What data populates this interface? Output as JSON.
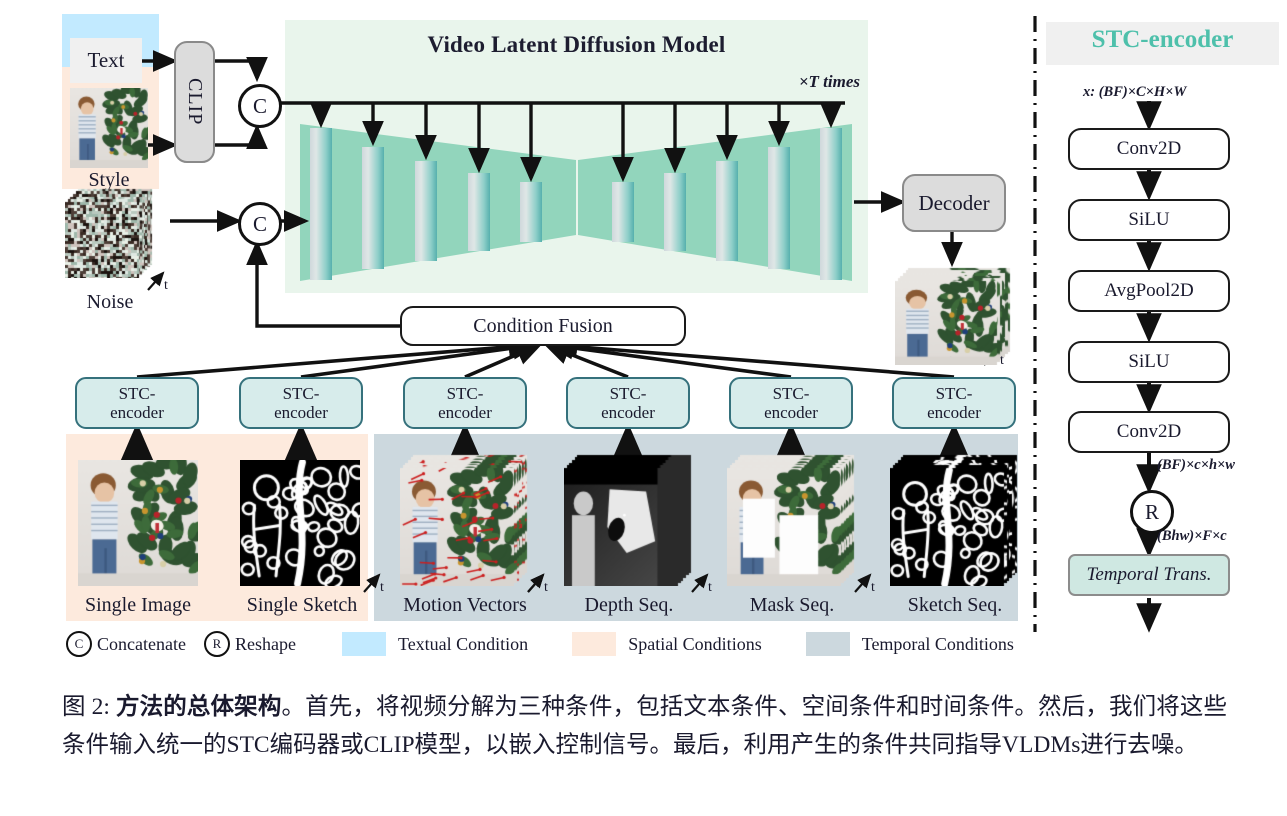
{
  "figure": {
    "panel_title": "Video Latent Diffusion Model",
    "times_label": "×T times",
    "decoder_label": "Decoder",
    "clip_label": "CLIP",
    "condition_fusion_label": "Condition Fusion",
    "concat_symbol": "C",
    "reshape_symbol": "R",
    "time_axis_label": "t"
  },
  "inputs": {
    "text_label": "Text",
    "style_label": "Style",
    "noise_label": "Noise"
  },
  "conditions": [
    {
      "label": "Single Image",
      "encoder": "STC-\nencoder",
      "group": "spatial"
    },
    {
      "label": "Single Sketch",
      "encoder": "STC-\nencoder",
      "group": "spatial"
    },
    {
      "label": "Motion Vectors",
      "encoder": "STC-\nencoder",
      "group": "temporal"
    },
    {
      "label": "Depth Seq.",
      "encoder": "STC-\nencoder",
      "group": "temporal"
    },
    {
      "label": "Mask Seq.",
      "encoder": "STC-\nencoder",
      "group": "temporal"
    },
    {
      "label": "Sketch Seq.",
      "encoder": "STC-\nencoder",
      "group": "temporal"
    }
  ],
  "encoder_label_line1": "STC-",
  "encoder_label_line2": "encoder",
  "stc_panel": {
    "title": "STC-encoder",
    "input_dim": "x: (BF)×C×H×W",
    "blocks": [
      "Conv2D",
      "SiLU",
      "AvgPool2D",
      "SiLU",
      "Conv2D"
    ],
    "dim_after_conv": "(BF)×c×h×w",
    "reshape_symbol": "R",
    "dim_after_reshape": "(Bhw)×F×c",
    "temporal_block": "Temporal Trans."
  },
  "legend": [
    {
      "kind": "circle",
      "symbol": "C",
      "label": "Concatenate"
    },
    {
      "kind": "circle",
      "symbol": "R",
      "label": "Reshape"
    },
    {
      "kind": "swatch",
      "color": "#c2eaff",
      "label": "Textual Condition"
    },
    {
      "kind": "swatch",
      "color": "#fdeadd",
      "label": "Spatial Conditions"
    },
    {
      "kind": "swatch",
      "color": "#ccd8de",
      "label": "Temporal Conditions"
    }
  ],
  "colors": {
    "textual": "#c2eaff",
    "spatial": "#fdeadd",
    "temporal": "#ccd8de",
    "panel_bg": "#e9f5ec",
    "trapezoid": "#92d5bc",
    "stc_box_fill": "#d7eceb",
    "stc_box_border": "#35717c",
    "stc_title": "#4ec0ab",
    "temporal_trans_fill": "#cfe8e2"
  },
  "caption": {
    "prefix": "图 2: ",
    "bold": "方法的总体架构",
    "rest": "。首先，将视频分解为三种条件，包括文本条件、空间条件和时间条件。然后，我们将这些条件输入统一的STC编码器或CLIP模型，以嵌入控制信号。最后，利用产生的条件共同指导VLDMs进行去噪。"
  }
}
